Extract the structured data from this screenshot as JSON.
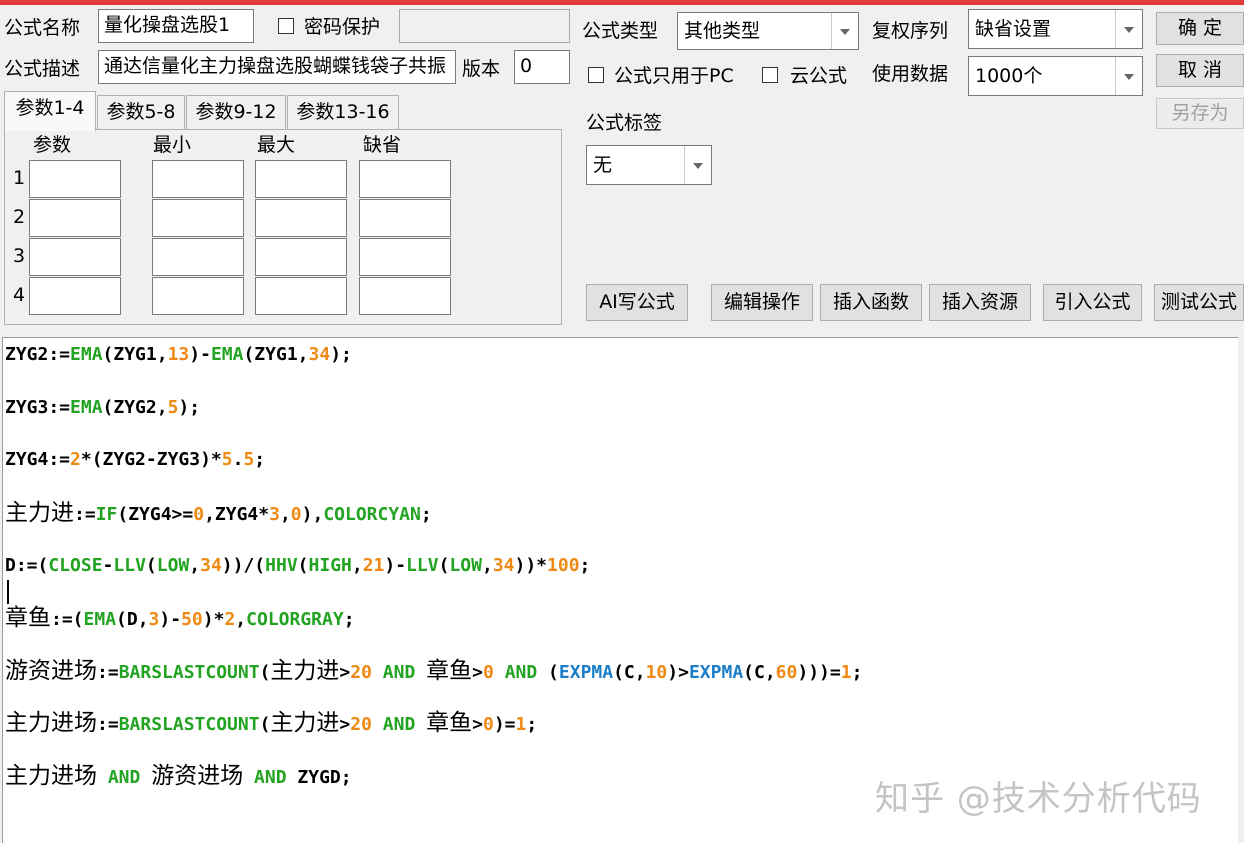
{
  "form": {
    "name_label": "公式名称",
    "name_value": "量化操盘选股1",
    "password_label": "密码保护",
    "desc_label": "公式描述",
    "desc_value": "通达信量化主力操盘选股蝴蝶钱袋子共振",
    "version_label": "版本",
    "version_value": "0",
    "type_label": "公式类型",
    "type_value": "其他类型",
    "pc_only_label": "公式只用于PC",
    "cloud_label": "云公式",
    "restore_label": "复权序列",
    "restore_value": "缺省设置",
    "data_label": "使用数据",
    "data_value": "1000个",
    "tag_label": "公式标签",
    "tag_value": "无"
  },
  "buttons": {
    "ok": "确 定",
    "cancel": "取 消",
    "save_as": "另存为",
    "ai": "AI写公式",
    "edit_op": "编辑操作",
    "insert_func": "插入函数",
    "insert_res": "插入资源",
    "import_formula": "引入公式",
    "test_formula": "测试公式"
  },
  "tabs": [
    "参数1-4",
    "参数5-8",
    "参数9-12",
    "参数13-16"
  ],
  "param_table": {
    "headers": [
      "参数",
      "最小",
      "最大",
      "缺省"
    ],
    "rows": [
      "1",
      "2",
      "3",
      "4"
    ]
  },
  "code_lines": [
    [
      {
        "t": "ZYG2:="
      },
      {
        "t": "EMA",
        "c": "kw"
      },
      {
        "t": "(ZYG1,"
      },
      {
        "t": "13",
        "c": "num"
      },
      {
        "t": ")-"
      },
      {
        "t": "EMA",
        "c": "kw"
      },
      {
        "t": "(ZYG1,"
      },
      {
        "t": "34",
        "c": "num"
      },
      {
        "t": ");"
      }
    ],
    [
      {
        "t": "ZYG3:="
      },
      {
        "t": "EMA",
        "c": "kw"
      },
      {
        "t": "(ZYG2,"
      },
      {
        "t": "5",
        "c": "num"
      },
      {
        "t": ");"
      }
    ],
    [
      {
        "t": "ZYG4:="
      },
      {
        "t": "2",
        "c": "num"
      },
      {
        "t": "*(ZYG2-ZYG3)*"
      },
      {
        "t": "5",
        "c": "num"
      },
      {
        "t": "."
      },
      {
        "t": "5",
        "c": "num"
      },
      {
        "t": ";"
      }
    ],
    [
      {
        "t": "主力进",
        "c": "cn"
      },
      {
        "t": ":="
      },
      {
        "t": "IF",
        "c": "kw"
      },
      {
        "t": "(ZYG4>="
      },
      {
        "t": "0",
        "c": "num"
      },
      {
        "t": ",ZYG4*"
      },
      {
        "t": "3",
        "c": "num"
      },
      {
        "t": ","
      },
      {
        "t": "0",
        "c": "num"
      },
      {
        "t": "),"
      },
      {
        "t": "COLORCYAN",
        "c": "kw"
      },
      {
        "t": ";"
      }
    ],
    [
      {
        "t": "D:=("
      },
      {
        "t": "CLOSE",
        "c": "kw"
      },
      {
        "t": "-"
      },
      {
        "t": "LLV",
        "c": "kw"
      },
      {
        "t": "("
      },
      {
        "t": "LOW",
        "c": "kw"
      },
      {
        "t": ","
      },
      {
        "t": "34",
        "c": "num"
      },
      {
        "t": "))/("
      },
      {
        "t": "HHV",
        "c": "kw"
      },
      {
        "t": "("
      },
      {
        "t": "HIGH",
        "c": "kw"
      },
      {
        "t": ","
      },
      {
        "t": "21",
        "c": "num"
      },
      {
        "t": ")-"
      },
      {
        "t": "LLV",
        "c": "kw"
      },
      {
        "t": "("
      },
      {
        "t": "LOW",
        "c": "kw"
      },
      {
        "t": ","
      },
      {
        "t": "34",
        "c": "num"
      },
      {
        "t": "))*"
      },
      {
        "t": "100",
        "c": "num"
      },
      {
        "t": ";"
      }
    ],
    [
      {
        "t": "章鱼",
        "c": "cn"
      },
      {
        "t": ":=("
      },
      {
        "t": "EMA",
        "c": "kw"
      },
      {
        "t": "(D,"
      },
      {
        "t": "3",
        "c": "num"
      },
      {
        "t": ")-"
      },
      {
        "t": "50",
        "c": "num"
      },
      {
        "t": ")*"
      },
      {
        "t": "2",
        "c": "num"
      },
      {
        "t": ","
      },
      {
        "t": "COLORGRAY",
        "c": "kw"
      },
      {
        "t": ";"
      }
    ],
    [
      {
        "t": "游资进场",
        "c": "cn"
      },
      {
        "t": ":="
      },
      {
        "t": "BARSLASTCOUNT",
        "c": "kw"
      },
      {
        "t": "("
      },
      {
        "t": "主力进",
        "c": "cn"
      },
      {
        "t": ">"
      },
      {
        "t": "20",
        "c": "num"
      },
      {
        "t": " "
      },
      {
        "t": "AND",
        "c": "kw"
      },
      {
        "t": " "
      },
      {
        "t": "章鱼",
        "c": "cn"
      },
      {
        "t": ">"
      },
      {
        "t": "0",
        "c": "num"
      },
      {
        "t": " "
      },
      {
        "t": "AND",
        "c": "kw"
      },
      {
        "t": " ("
      },
      {
        "t": "EXPMA",
        "c": "blue"
      },
      {
        "t": "(C,"
      },
      {
        "t": "10",
        "c": "num"
      },
      {
        "t": ")>"
      },
      {
        "t": "EXPMA",
        "c": "blue"
      },
      {
        "t": "(C,"
      },
      {
        "t": "60",
        "c": "num"
      },
      {
        "t": ")))="
      },
      {
        "t": "1",
        "c": "num"
      },
      {
        "t": ";"
      }
    ],
    [
      {
        "t": "主力进场",
        "c": "cn"
      },
      {
        "t": ":="
      },
      {
        "t": "BARSLASTCOUNT",
        "c": "kw"
      },
      {
        "t": "("
      },
      {
        "t": "主力进",
        "c": "cn"
      },
      {
        "t": ">"
      },
      {
        "t": "20",
        "c": "num"
      },
      {
        "t": " "
      },
      {
        "t": "AND",
        "c": "kw"
      },
      {
        "t": " "
      },
      {
        "t": "章鱼",
        "c": "cn"
      },
      {
        "t": ">"
      },
      {
        "t": "0",
        "c": "num"
      },
      {
        "t": ")="
      },
      {
        "t": "1",
        "c": "num"
      },
      {
        "t": ";"
      }
    ],
    [
      {
        "t": "主力进场",
        "c": "cn"
      },
      {
        "t": " "
      },
      {
        "t": "AND",
        "c": "kw"
      },
      {
        "t": " "
      },
      {
        "t": "游资进场",
        "c": "cn"
      },
      {
        "t": " "
      },
      {
        "t": "AND",
        "c": "kw"
      },
      {
        "t": " ZYGD;"
      }
    ]
  ],
  "watermark": "知乎 @技术分析代码"
}
